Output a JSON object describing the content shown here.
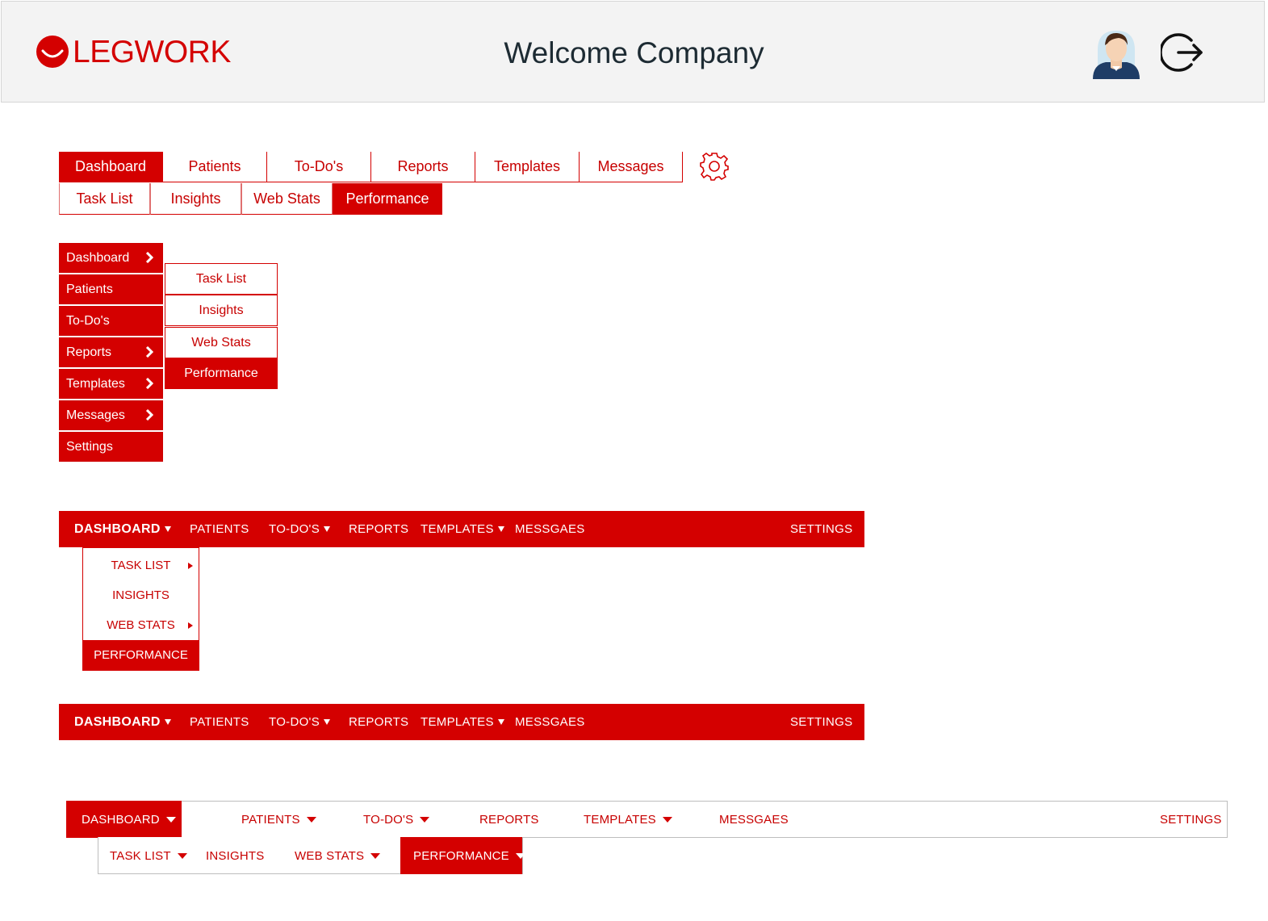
{
  "header": {
    "logo_text": "LEGWORK",
    "welcome": "Welcome Company",
    "brand_color": "#d40000",
    "avatar_icon": "user-avatar-icon",
    "logout_icon": "logout-icon"
  },
  "style1": {
    "tabs": [
      "Dashboard",
      "Patients",
      "To-Do's",
      "Reports",
      "Templates",
      "Messages"
    ],
    "active_tab": "Dashboard",
    "subtabs": [
      "Task List",
      "Insights",
      "Web Stats",
      "Performance"
    ],
    "active_subtab": "Performance",
    "settings_icon": "gear-icon"
  },
  "style2": {
    "items": [
      "Dashboard",
      "Patients",
      "To-Do's",
      "Reports",
      "Templates",
      "Messages",
      "Settings"
    ],
    "submenu": [
      "Task List",
      "Insights",
      "Web Stats",
      "Performance"
    ],
    "active_submenu": "Performance"
  },
  "style3": {
    "items": [
      "DASHBOARD",
      "PATIENTS",
      "TO-DO'S",
      "REPORTS",
      "TEMPLATES",
      "MESSGAES"
    ],
    "settings": "SETTINGS",
    "dropdown": [
      "TASK LIST",
      "INSIGHTS",
      "WEB STATS",
      "PERFORMANCE"
    ],
    "active_dropdown": "PERFORMANCE"
  },
  "style4": {
    "items": [
      "DASHBOARD",
      "PATIENTS",
      "TO-DO'S",
      "REPORTS",
      "TEMPLATES",
      "MESSGAES"
    ],
    "settings": "SETTINGS"
  },
  "style5": {
    "items": [
      "DASHBOARD",
      "PATIENTS",
      "TO-DO'S",
      "REPORTS",
      "TEMPLATES",
      "MESSGAES"
    ],
    "settings": "SETTINGS",
    "subitems": [
      "TASK LIST",
      "INSIGHTS",
      "WEB STATS",
      "PERFORMANCE"
    ],
    "active_subitem": "PERFORMANCE"
  }
}
